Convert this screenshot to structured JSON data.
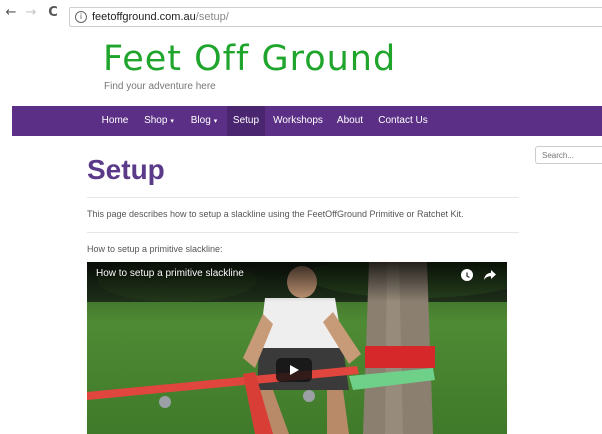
{
  "browser": {
    "back": "←",
    "forward": "→",
    "reload": "C",
    "info": "i",
    "url_host": "feetoffground.com.au",
    "url_path": "/setup/"
  },
  "site": {
    "logo": "Feet Off Ground",
    "tagline": "Find your adventure here",
    "accent": "#5b2f86",
    "logo_color": "#1fa52b"
  },
  "menu": [
    {
      "label": "Home",
      "dropdown": false
    },
    {
      "label": "Shop",
      "dropdown": true
    },
    {
      "label": "Blog",
      "dropdown": true
    },
    {
      "label": "Setup",
      "dropdown": false,
      "active": true
    },
    {
      "label": "Workshops",
      "dropdown": false
    },
    {
      "label": "About",
      "dropdown": false
    },
    {
      "label": "Contact Us",
      "dropdown": false
    }
  ],
  "menu_caret": "▾",
  "search": {
    "placeholder": "Search..."
  },
  "page": {
    "title": "Setup",
    "intro": "This page describes how to setup a slackline using the FeetOffGround Primitive or Ratchet Kit.",
    "subheading": "How to setup a primitive slackline:"
  },
  "video": {
    "title": "How to setup a primitive slackline",
    "icons": [
      "clock-icon",
      "share-icon",
      "play-icon"
    ]
  }
}
